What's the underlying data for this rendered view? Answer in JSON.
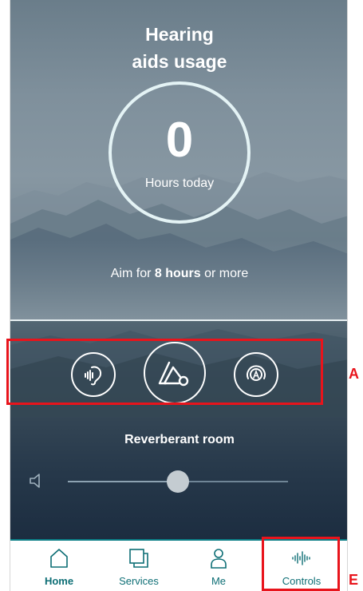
{
  "header": {
    "title_line1": "Hearing",
    "title_line2": "aids usage"
  },
  "usage": {
    "value": "0",
    "caption": "Hours today",
    "aim_prefix": "Aim for ",
    "aim_bold": "8 hours",
    "aim_suffix": " or more"
  },
  "programs": {
    "buttons": [
      {
        "icon": "hearing-aid-icon"
      },
      {
        "icon": "program-shapes-icon"
      },
      {
        "icon": "auto-program-icon",
        "glyph": "A"
      }
    ],
    "current": "Reverberant room"
  },
  "volume": {
    "icon": "speaker-icon",
    "level": 0.5
  },
  "annotations": {
    "box_a_label": "A",
    "box_e_label": "E",
    "color": "#e8141c"
  },
  "nav": {
    "items": [
      {
        "label": "Home",
        "icon": "home-icon",
        "active": true
      },
      {
        "label": "Services",
        "icon": "services-icon",
        "active": false
      },
      {
        "label": "Me",
        "icon": "person-icon",
        "active": false
      },
      {
        "label": "Controls",
        "icon": "sound-wave-icon",
        "active": false
      }
    ],
    "accent": "#0c7f86"
  }
}
